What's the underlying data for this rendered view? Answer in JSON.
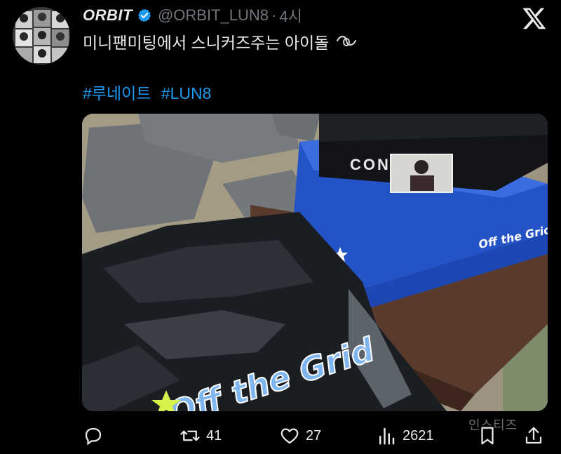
{
  "author": {
    "name": "ORBIT",
    "handle": "@ORBIT_LUN8",
    "time": "4시",
    "verified_color": "#1d9bf0"
  },
  "tweet": {
    "text": "미니팬미팅에서 스니커즈주는 아이돌",
    "hashtags": [
      "#루네이트",
      "#LUN8"
    ]
  },
  "media": {
    "box_brand": "CONVERSE",
    "box_color": "#2453c8",
    "bag_text": "Off the Grid"
  },
  "actions": {
    "reply_icon": "reply-icon",
    "retweet_icon": "retweet-icon",
    "retweets": "41",
    "like_icon": "heart-icon",
    "likes": "27",
    "views_icon": "views-icon",
    "views": "2621",
    "bookmark_icon": "bookmark-icon",
    "share_icon": "share-icon"
  },
  "watermark": "인스티즈"
}
